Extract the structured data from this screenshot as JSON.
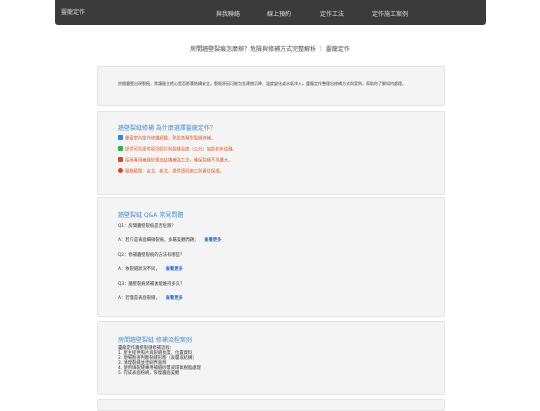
{
  "nav": {
    "brand": "靈龍定作",
    "items": [
      "與我聯絡",
      "線上預約",
      "定作工法",
      "定作施工案例"
    ]
  },
  "page": {
    "title": "房間牆壁裂痕怎麼辦？危險與修補方式完整解析 ｜ 靈龍定作"
  },
  "intro": {
    "text": "房間牆壁出現裂痕，常讓屋主擔心是否影響結構安全。裂痕原因可能包含建物沉降、溫度變化或水氣滲入。靈龍定作整理出修補方式與案例，幫助你了解如何處理。"
  },
  "reasons": {
    "title": "牆壁裂縫修補 為什麼選擇靈龍定作？",
    "items": [
      {
        "icon": "wrench-icon",
        "color": "#3a86d6",
        "text": "豐富室內定作修繕經驗，熟悉各類型裂縫修補。"
      },
      {
        "icon": "check-icon",
        "color": "#2bb24c",
        "text": "提供可先提供現況照片與裂縫長度（公分）協助初步估價。"
      },
      {
        "icon": "block-icon",
        "color": "#c0542a",
        "text": "採用專用補縫砂漿或結構補強工法，確保裂縫不再擴大。"
      },
      {
        "icon": "pin-icon",
        "color": "#d9453b",
        "text": "服務範圍：台北、新北，提供透明施工與責任保證。"
      }
    ]
  },
  "qa": {
    "title": "牆壁裂縫 Q&A 常見問題",
    "more_label": "查看更多",
    "lines": [
      {
        "text": "Q1：房間牆壁裂痕是否危險？",
        "more": false
      },
      {
        "text": "A：若只是表面細微裂痕，多屬美觀問題；",
        "more": true
      },
      {
        "text": "Q2：修補牆壁裂痕的方法有哪些？",
        "more": false
      },
      {
        "text": "A：依裂縫狀況不同，",
        "more": true
      },
      {
        "text": "Q3：牆壁裂痕修補後能維持多久？",
        "more": false
      },
      {
        "text": "A：若僅是表面裂縫，",
        "more": true
      }
    ]
  },
  "process": {
    "title": "房間牆壁裂縫 修補流程案例",
    "subtitle": "靈龍定作牆壁裂縫修補流程：",
    "steps": [
      "1. 屋主提供照片與裂縫長度、位置資料",
      "2. 現場勘查判斷裂縫形態（表層或結構）",
      "3. 清理裂縫並塗刷界面劑",
      "4. 使用填裂縫專用補縫砂漿或環氧樹脂處理",
      "5. 完成表面粉刷，恢復牆面美觀"
    ]
  }
}
